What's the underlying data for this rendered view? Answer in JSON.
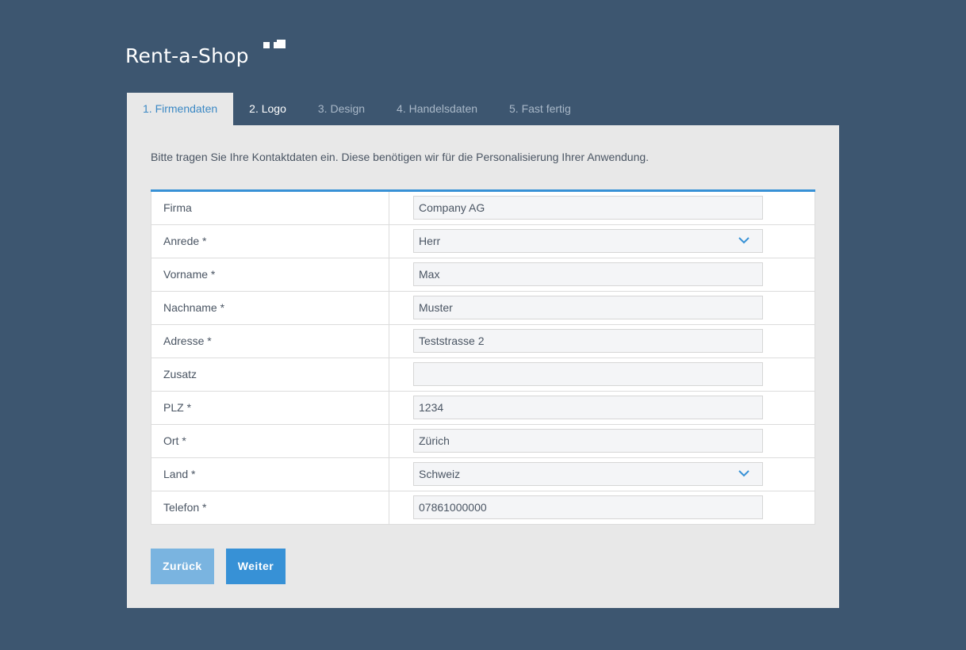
{
  "brand": {
    "name": "Rent-a-Shop"
  },
  "tabs": [
    {
      "label": "1. Firmendaten",
      "state": "active"
    },
    {
      "label": "2. Logo",
      "state": "done"
    },
    {
      "label": "3. Design",
      "state": "pending"
    },
    {
      "label": "4. Handelsdaten",
      "state": "pending"
    },
    {
      "label": "5. Fast fertig",
      "state": "pending"
    }
  ],
  "intro": "Bitte tragen Sie Ihre Kontaktdaten ein. Diese benötigen wir für die Personalisierung Ihrer Anwendung.",
  "form": {
    "fields": [
      {
        "label": "Firma",
        "value": "Company AG",
        "type": "text"
      },
      {
        "label": "Anrede *",
        "value": "Herr",
        "type": "select"
      },
      {
        "label": "Vorname *",
        "value": "Max",
        "type": "text"
      },
      {
        "label": "Nachname *",
        "value": "Muster",
        "type": "text"
      },
      {
        "label": "Adresse *",
        "value": "Teststrasse 2",
        "type": "text"
      },
      {
        "label": "Zusatz",
        "value": "",
        "type": "text"
      },
      {
        "label": "PLZ *",
        "value": "1234",
        "type": "text"
      },
      {
        "label": "Ort *",
        "value": "Zürich",
        "type": "text"
      },
      {
        "label": "Land *",
        "value": "Schweiz",
        "type": "select"
      },
      {
        "label": "Telefon *",
        "value": "07861000000",
        "type": "text"
      }
    ]
  },
  "buttons": {
    "back_label": "Zurück",
    "next_label": "Weiter"
  },
  "colors": {
    "background": "#3d5670",
    "accent": "#3791d6",
    "accent_light": "#7ab4e0",
    "panel": "#e8e8e8",
    "active_tab_text": "#3b88c4"
  },
  "icons": {
    "select": "chevron-down-icon"
  }
}
